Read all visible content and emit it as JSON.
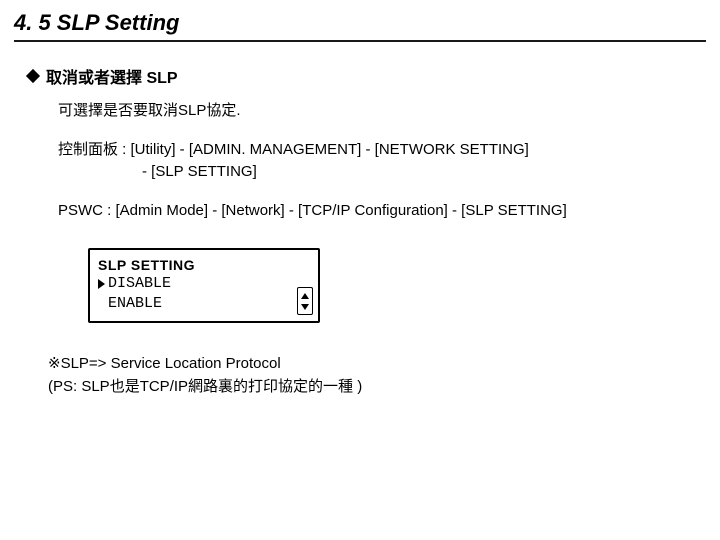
{
  "title": "4. 5 SLP Setting",
  "section": {
    "heading": "取消或者選擇 SLP",
    "line1": "可選擇是否要取消SLP協定.",
    "panel_label": "控制面板 : [Utility] - [ADMIN. MANAGEMENT] - [NETWORK SETTING]",
    "panel_label_sub": "- [SLP SETTING]",
    "pswc": "PSWC : [Admin Mode] - [Network] - [TCP/IP Configuration] - [SLP SETTING]"
  },
  "lcd": {
    "title": "SLP SETTING",
    "option_selected": "DISABLE",
    "option_other": "ENABLE"
  },
  "footnote": {
    "line1": "※SLP=> Service Location Protocol",
    "line2": "(PS: SLP也是TCP/IP網路裏的打印協定的一種 )"
  }
}
